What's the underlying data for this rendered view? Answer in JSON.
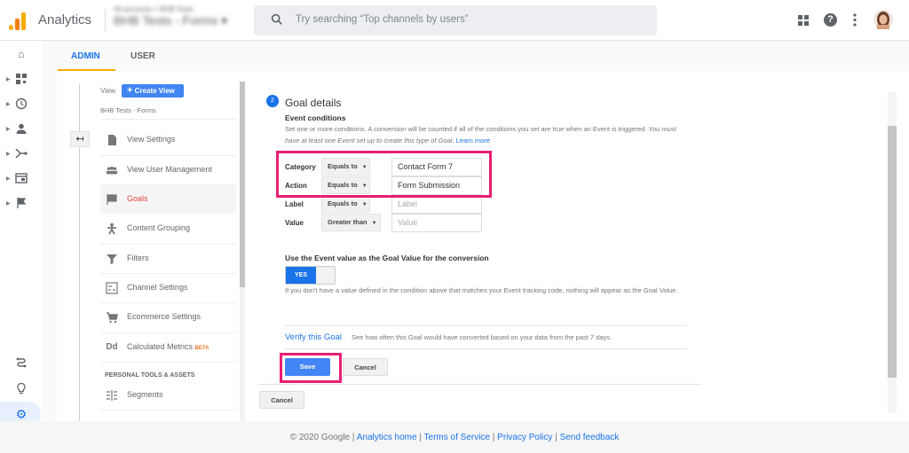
{
  "header": {
    "app_name": "Analytics",
    "account_path": "All accounts > BHB Tests",
    "account_view": "BHB Tests - Forms",
    "search_placeholder": "Try searching “Top channels by users”",
    "colors": {
      "brand": "#f9ab00",
      "accent": "#1a73e8",
      "highlight": "#e91e73"
    }
  },
  "left_nav": {
    "icons": [
      "home-icon",
      "customization-icon",
      "realtime-icon",
      "audience-icon",
      "acquisition-icon",
      "behavior-icon",
      "conversions-icon",
      "attribution-icon",
      "discover-icon",
      "admin-gear-icon",
      "expand-icon"
    ]
  },
  "tabs": [
    {
      "label": "ADMIN",
      "active": true
    },
    {
      "label": "USER",
      "active": false
    }
  ],
  "view_column": {
    "view_label": "View",
    "create_view": "Create View",
    "view_name": "BHB Tests - Forms",
    "items": [
      {
        "label": "View Settings",
        "icon": "document-icon"
      },
      {
        "label": "View User Management",
        "icon": "users-icon"
      },
      {
        "label": "Goals",
        "icon": "flag-icon",
        "selected": true
      },
      {
        "label": "Content Grouping",
        "icon": "content-grouping-icon"
      },
      {
        "label": "Filters",
        "icon": "filter-icon"
      },
      {
        "label": "Channel Settings",
        "icon": "channel-settings-icon"
      },
      {
        "label": "Ecommerce Settings",
        "icon": "cart-icon"
      },
      {
        "label": "Calculated Metrics",
        "icon": "dd-icon",
        "badge": "BETA"
      }
    ],
    "section_header": "PERSONAL TOOLS & ASSETS",
    "section_items": [
      {
        "label": "Segments",
        "icon": "segments-icon"
      }
    ]
  },
  "goal": {
    "step": "2",
    "title": "Goal details",
    "subtitle": "Event conditions",
    "description": "Set one or more conditions. A conversion will be counted if all of the conditions you set are true when an Event is triggered.",
    "description_italic": "You must have at least one Event set up to create this type of Goal.",
    "learn_more": "Learn more",
    "conditions": [
      {
        "label": "Category",
        "operator": "Equals to",
        "value": "Contact Form 7",
        "placeholder": ""
      },
      {
        "label": "Action",
        "operator": "Equals to",
        "value": "Form Submission",
        "placeholder": ""
      },
      {
        "label": "Label",
        "operator": "Equals to",
        "value": "",
        "placeholder": "Label"
      },
      {
        "label": "Value",
        "operator": "Greater than",
        "value": "",
        "placeholder": "Value"
      }
    ],
    "use_value_label": "Use the Event value as the Goal Value for the conversion",
    "toggle_state": "YES",
    "toggle_note": "If you don't have a value defined in the condition above that matches your Event tracking code, nothing will appear as the Goal Value.",
    "verify_link": "Verify this Goal",
    "verify_note": "See how often this Goal would have converted based on your data from the past 7 days.",
    "save": "Save",
    "cancel": "Cancel",
    "outer_cancel": "Cancel"
  },
  "footer": {
    "copyright": "© 2020 Google",
    "links": [
      "Analytics home",
      "Terms of Service",
      "Privacy Policy",
      "Send feedback"
    ],
    "sep": " | "
  }
}
